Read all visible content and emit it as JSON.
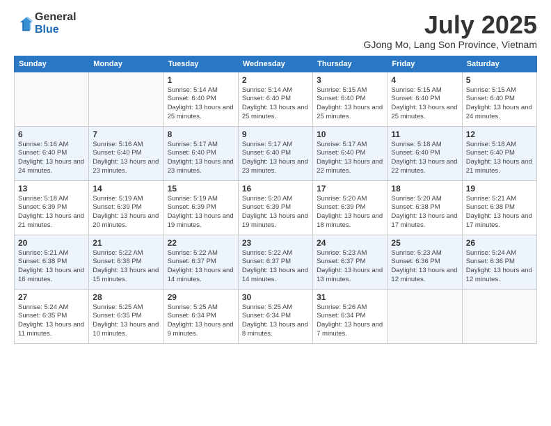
{
  "logo": {
    "general": "General",
    "blue": "Blue"
  },
  "title": "July 2025",
  "location": "GJong Mo, Lang Son Province, Vietnam",
  "days_of_week": [
    "Sunday",
    "Monday",
    "Tuesday",
    "Wednesday",
    "Thursday",
    "Friday",
    "Saturday"
  ],
  "weeks": [
    [
      {
        "day": "",
        "info": ""
      },
      {
        "day": "",
        "info": ""
      },
      {
        "day": "1",
        "info": "Sunrise: 5:14 AM\nSunset: 6:40 PM\nDaylight: 13 hours and 25 minutes."
      },
      {
        "day": "2",
        "info": "Sunrise: 5:14 AM\nSunset: 6:40 PM\nDaylight: 13 hours and 25 minutes."
      },
      {
        "day": "3",
        "info": "Sunrise: 5:15 AM\nSunset: 6:40 PM\nDaylight: 13 hours and 25 minutes."
      },
      {
        "day": "4",
        "info": "Sunrise: 5:15 AM\nSunset: 6:40 PM\nDaylight: 13 hours and 25 minutes."
      },
      {
        "day": "5",
        "info": "Sunrise: 5:15 AM\nSunset: 6:40 PM\nDaylight: 13 hours and 24 minutes."
      }
    ],
    [
      {
        "day": "6",
        "info": "Sunrise: 5:16 AM\nSunset: 6:40 PM\nDaylight: 13 hours and 24 minutes."
      },
      {
        "day": "7",
        "info": "Sunrise: 5:16 AM\nSunset: 6:40 PM\nDaylight: 13 hours and 23 minutes."
      },
      {
        "day": "8",
        "info": "Sunrise: 5:17 AM\nSunset: 6:40 PM\nDaylight: 13 hours and 23 minutes."
      },
      {
        "day": "9",
        "info": "Sunrise: 5:17 AM\nSunset: 6:40 PM\nDaylight: 13 hours and 23 minutes."
      },
      {
        "day": "10",
        "info": "Sunrise: 5:17 AM\nSunset: 6:40 PM\nDaylight: 13 hours and 22 minutes."
      },
      {
        "day": "11",
        "info": "Sunrise: 5:18 AM\nSunset: 6:40 PM\nDaylight: 13 hours and 22 minutes."
      },
      {
        "day": "12",
        "info": "Sunrise: 5:18 AM\nSunset: 6:40 PM\nDaylight: 13 hours and 21 minutes."
      }
    ],
    [
      {
        "day": "13",
        "info": "Sunrise: 5:18 AM\nSunset: 6:39 PM\nDaylight: 13 hours and 21 minutes."
      },
      {
        "day": "14",
        "info": "Sunrise: 5:19 AM\nSunset: 6:39 PM\nDaylight: 13 hours and 20 minutes."
      },
      {
        "day": "15",
        "info": "Sunrise: 5:19 AM\nSunset: 6:39 PM\nDaylight: 13 hours and 19 minutes."
      },
      {
        "day": "16",
        "info": "Sunrise: 5:20 AM\nSunset: 6:39 PM\nDaylight: 13 hours and 19 minutes."
      },
      {
        "day": "17",
        "info": "Sunrise: 5:20 AM\nSunset: 6:39 PM\nDaylight: 13 hours and 18 minutes."
      },
      {
        "day": "18",
        "info": "Sunrise: 5:20 AM\nSunset: 6:38 PM\nDaylight: 13 hours and 17 minutes."
      },
      {
        "day": "19",
        "info": "Sunrise: 5:21 AM\nSunset: 6:38 PM\nDaylight: 13 hours and 17 minutes."
      }
    ],
    [
      {
        "day": "20",
        "info": "Sunrise: 5:21 AM\nSunset: 6:38 PM\nDaylight: 13 hours and 16 minutes."
      },
      {
        "day": "21",
        "info": "Sunrise: 5:22 AM\nSunset: 6:38 PM\nDaylight: 13 hours and 15 minutes."
      },
      {
        "day": "22",
        "info": "Sunrise: 5:22 AM\nSunset: 6:37 PM\nDaylight: 13 hours and 14 minutes."
      },
      {
        "day": "23",
        "info": "Sunrise: 5:22 AM\nSunset: 6:37 PM\nDaylight: 13 hours and 14 minutes."
      },
      {
        "day": "24",
        "info": "Sunrise: 5:23 AM\nSunset: 6:37 PM\nDaylight: 13 hours and 13 minutes."
      },
      {
        "day": "25",
        "info": "Sunrise: 5:23 AM\nSunset: 6:36 PM\nDaylight: 13 hours and 12 minutes."
      },
      {
        "day": "26",
        "info": "Sunrise: 5:24 AM\nSunset: 6:36 PM\nDaylight: 13 hours and 12 minutes."
      }
    ],
    [
      {
        "day": "27",
        "info": "Sunrise: 5:24 AM\nSunset: 6:35 PM\nDaylight: 13 hours and 11 minutes."
      },
      {
        "day": "28",
        "info": "Sunrise: 5:25 AM\nSunset: 6:35 PM\nDaylight: 13 hours and 10 minutes."
      },
      {
        "day": "29",
        "info": "Sunrise: 5:25 AM\nSunset: 6:34 PM\nDaylight: 13 hours and 9 minutes."
      },
      {
        "day": "30",
        "info": "Sunrise: 5:25 AM\nSunset: 6:34 PM\nDaylight: 13 hours and 8 minutes."
      },
      {
        "day": "31",
        "info": "Sunrise: 5:26 AM\nSunset: 6:34 PM\nDaylight: 13 hours and 7 minutes."
      },
      {
        "day": "",
        "info": ""
      },
      {
        "day": "",
        "info": ""
      }
    ]
  ]
}
